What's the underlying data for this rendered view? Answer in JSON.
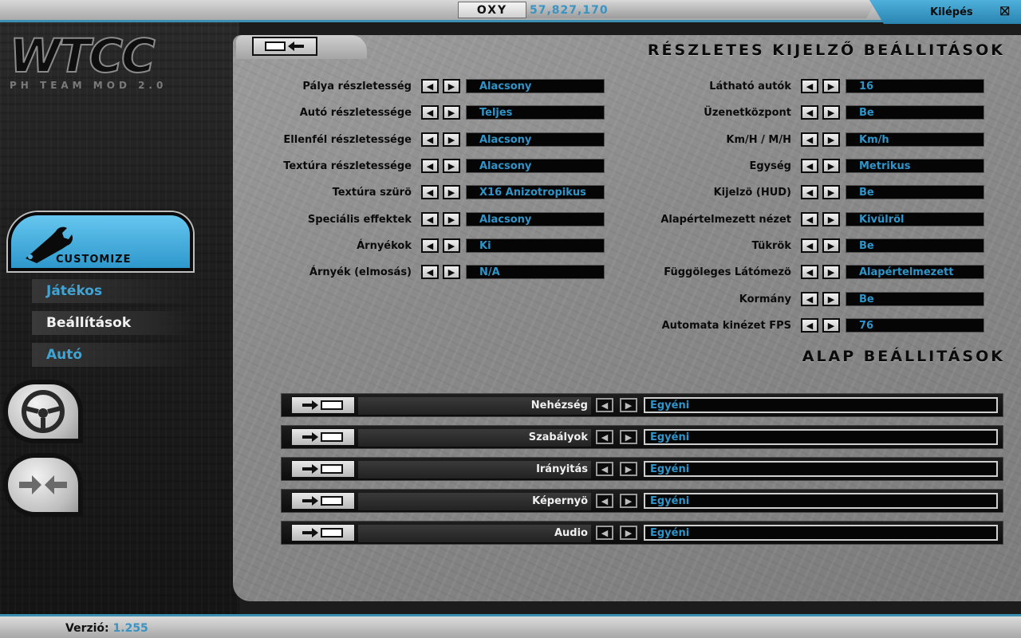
{
  "topbar": {
    "player": "OXY",
    "money": "57,827,170",
    "exit_label": "Kilépés",
    "exit_icon": "close-icon"
  },
  "logo": {
    "title": "WTCC",
    "subtitle": "PH TEAM MOD 2.0"
  },
  "sidebar": {
    "customize_label": "CUSTOMIZE",
    "items": [
      {
        "label": "Játékos"
      },
      {
        "label": "Beállítások"
      },
      {
        "label": "Autó"
      }
    ]
  },
  "display_settings": {
    "title": "RÉSZLETES KIJELZŐ BEÁLLITÁSOK",
    "left": [
      {
        "label": "Pálya részletesség",
        "value": "Alacsony"
      },
      {
        "label": "Autó részletessége",
        "value": "Teljes"
      },
      {
        "label": "Ellenfél részletessége",
        "value": "Alacsony"
      },
      {
        "label": "Textúra részletessége",
        "value": "Alacsony"
      },
      {
        "label": "Textúra szürö",
        "value": "X16 Anizotropikus"
      },
      {
        "label": "Speciális effektek",
        "value": "Alacsony"
      },
      {
        "label": "Árnyékok",
        "value": "Ki"
      },
      {
        "label": "Árnyék (elmosás)",
        "value": "N/A"
      }
    ],
    "right": [
      {
        "label": "Látható autók",
        "value": "16"
      },
      {
        "label": "Üzenetközpont",
        "value": "Be"
      },
      {
        "label": "Km/H / M/H",
        "value": "Km/h"
      },
      {
        "label": "Egység",
        "value": "Metrikus"
      },
      {
        "label": "Kijelzö (HUD)",
        "value": "Be"
      },
      {
        "label": "Alapértelmezett nézet",
        "value": "Kivülröl"
      },
      {
        "label": "Tükrök",
        "value": "Be"
      },
      {
        "label": "Függöleges Látómezö",
        "value": "Alapértelmezett"
      },
      {
        "label": "Kormány",
        "value": "Be"
      },
      {
        "label": "Automata kinézet FPS",
        "value": "76"
      }
    ]
  },
  "base_settings": {
    "title": "ALAP BEÁLLITÁSOK",
    "items": [
      {
        "label": "Nehézség",
        "value": "Egyéni"
      },
      {
        "label": "Szabályok",
        "value": "Egyéni"
      },
      {
        "label": "Irányitás",
        "value": "Egyéni"
      },
      {
        "label": "Képernyö",
        "value": "Egyéni"
      },
      {
        "label": "Audio",
        "value": "Egyéni"
      }
    ]
  },
  "footer": {
    "version_label": "Verzió:",
    "version_value": "1.255"
  },
  "colors": {
    "accent": "#3a93c3",
    "value_text": "#2f95c9"
  }
}
